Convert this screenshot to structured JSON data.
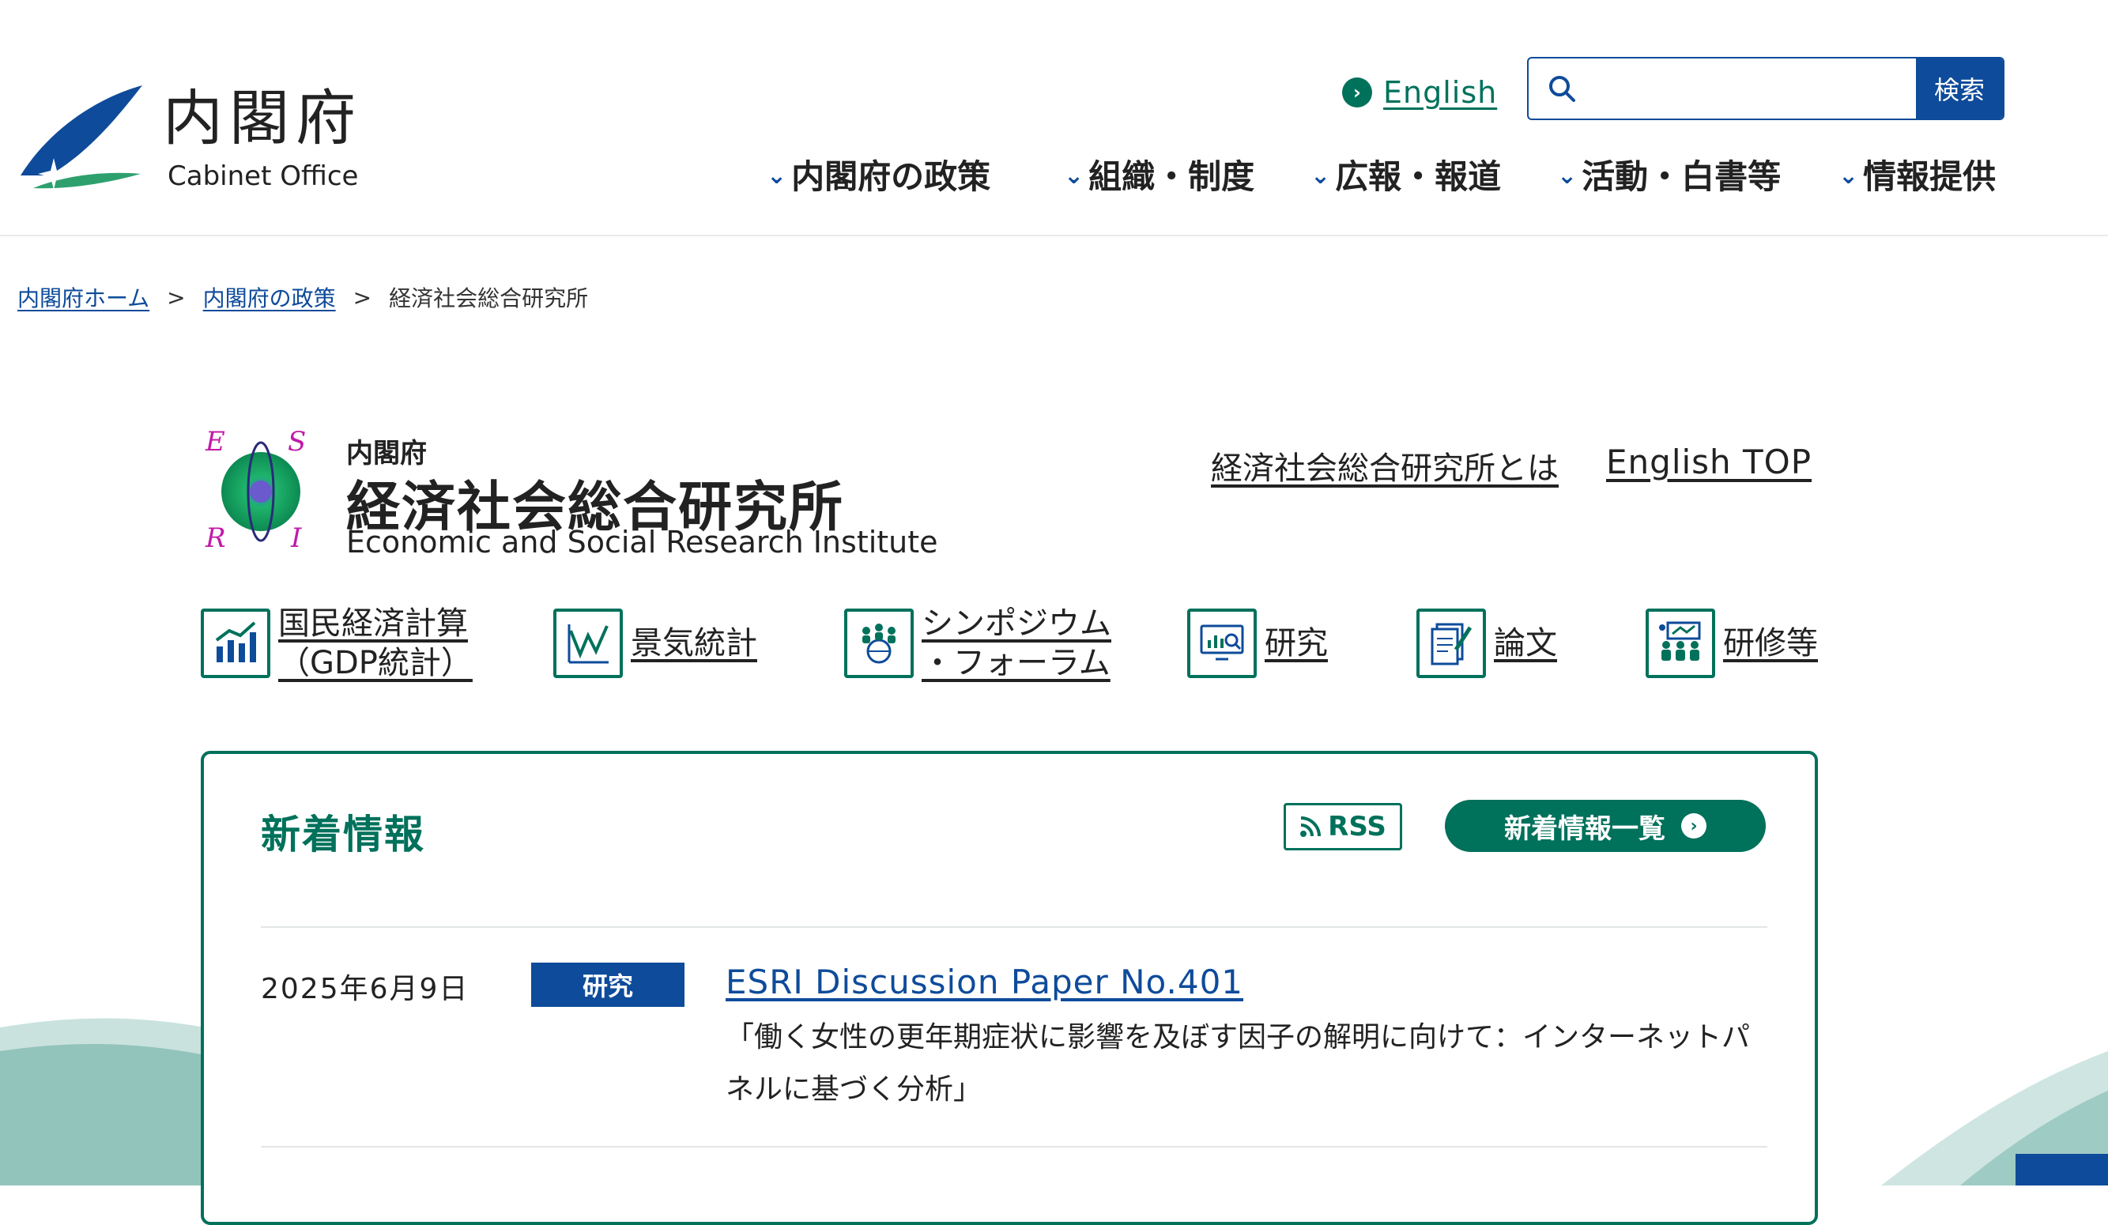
{
  "header": {
    "logo_title": "内閣府",
    "logo_subtitle": "Cabinet Office",
    "language_link": "English",
    "search": {
      "placeholder": "",
      "button_label": "検索"
    },
    "nav": [
      {
        "label": "内閣府の政策"
      },
      {
        "label": "組織・制度"
      },
      {
        "label": "広報・報道"
      },
      {
        "label": "活動・白書等"
      },
      {
        "label": "情報提供"
      }
    ]
  },
  "breadcrumb": {
    "home": "内閣府ホーム",
    "policy": "内閣府の政策",
    "current": "経済社会総合研究所",
    "separator": ">"
  },
  "esri": {
    "logo_letters": [
      "E",
      "S",
      "R",
      "I"
    ],
    "small_title": "内閣府",
    "name": "経済社会総合研究所",
    "english_name": "Economic and Social Research Institute",
    "about_link": "経済社会総合研究所とは",
    "english_top_link": "English TOP"
  },
  "categories": [
    {
      "line1": "国民経済計算",
      "line2": "（GDP統計）",
      "icon": "bar-chart-icon"
    },
    {
      "line1": "景気統計",
      "icon": "line-chart-icon"
    },
    {
      "line1": "シンポジウム",
      "line2": "・フォーラム",
      "icon": "people-globe-icon"
    },
    {
      "line1": "研究",
      "icon": "monitor-analysis-icon"
    },
    {
      "line1": "論文",
      "icon": "document-pen-icon"
    },
    {
      "line1": "研修等",
      "icon": "training-icon"
    }
  ],
  "news": {
    "title": "新着情報",
    "rss_label": "RSS",
    "all_label": "新着情報一覧",
    "items": [
      {
        "date": "2025年6月9日",
        "tag": "研究",
        "title": "ESRI Discussion Paper No.401",
        "description": "「働く女性の更年期症状に影響を及ぼす因子の解明に向けて：インターネットパネルに基づく分析」"
      }
    ]
  },
  "colors": {
    "brand_green": "#00715b",
    "brand_blue": "#0e4b9a"
  }
}
